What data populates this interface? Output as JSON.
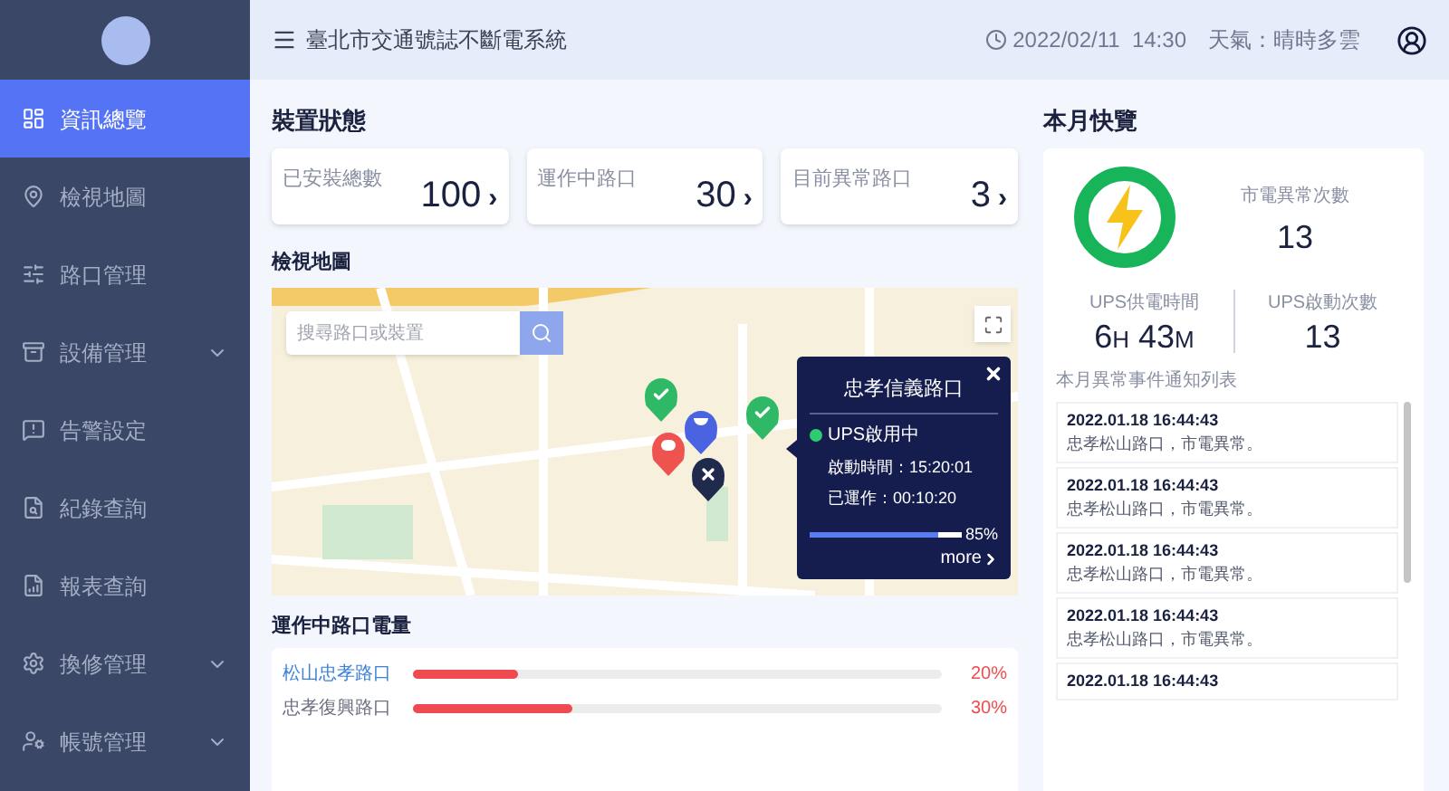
{
  "header": {
    "title": "臺北市交通號誌不斷電系統",
    "datetime": "2022/02/11  14:30",
    "weather": "天氣：晴時多雲"
  },
  "sidebar": {
    "items": [
      {
        "label": "資訊總覽",
        "selected": true,
        "expandable": false
      },
      {
        "label": "檢視地圖",
        "selected": false,
        "expandable": false
      },
      {
        "label": "路口管理",
        "selected": false,
        "expandable": false
      },
      {
        "label": "設備管理",
        "selected": false,
        "expandable": true
      },
      {
        "label": "告警設定",
        "selected": false,
        "expandable": false
      },
      {
        "label": "紀錄查詢",
        "selected": false,
        "expandable": false
      },
      {
        "label": "報表查詢",
        "selected": false,
        "expandable": false
      },
      {
        "label": "換修管理",
        "selected": false,
        "expandable": true
      },
      {
        "label": "帳號管理",
        "selected": false,
        "expandable": true
      }
    ]
  },
  "device_status": {
    "title": "裝置狀態",
    "cards": [
      {
        "label": "已安裝總數",
        "value": "100",
        "arrow": "›"
      },
      {
        "label": "運作中路口",
        "value": "30",
        "arrow": "›"
      },
      {
        "label": "目前異常路口",
        "value": "3",
        "arrow": "›"
      }
    ]
  },
  "map": {
    "title": "檢視地圖",
    "search": {
      "placeholder": "搜尋路口或裝置"
    },
    "pins": [
      {
        "kind": "ok",
        "color": "#2fb865"
      },
      {
        "kind": "standby",
        "color": "#4a63e0"
      },
      {
        "kind": "ok",
        "color": "#2fb865"
      },
      {
        "kind": "alarm",
        "color": "#ef5350"
      },
      {
        "kind": "offline",
        "color": "#1f2a4d"
      }
    ],
    "popup": {
      "title": "忠孝信義路口",
      "status": {
        "text": "UPS啟用中",
        "color": "#2ecc71"
      },
      "start": "啟動時間：15:20:01",
      "runtime": "已運作：00:10:20",
      "level": 0.85,
      "reading": "85%",
      "more": "more"
    }
  },
  "power": {
    "title": "運作中路口電量",
    "rows": [
      {
        "name": "松山忠孝路口",
        "selected": true,
        "level": 0.2,
        "reading": "20%"
      },
      {
        "name": "忠孝復興路口",
        "selected": false,
        "level": 0.3,
        "reading": "30%"
      }
    ]
  },
  "monthly": {
    "title": "本月快覽",
    "mains_label": "市電異常次數",
    "mains_value": "13",
    "ups_time_label": "UPS供電時間",
    "ups_hours": "6",
    "ups_h_unit": "H",
    "ups_minutes": "43",
    "ups_m_unit": "M",
    "ups_count_label": "UPS啟動次數",
    "ups_count": "13",
    "events_title": "本月異常事件通知列表",
    "events": [
      {
        "time": "2022.01.18 16:44:43",
        "text": "忠孝松山路口，市電異常。"
      },
      {
        "time": "2022.01.18 16:44:43",
        "text": "忠孝松山路口，市電異常。"
      },
      {
        "time": "2022.01.18 16:44:43",
        "text": "忠孝松山路口，市電異常。"
      },
      {
        "time": "2022.01.18 16:44:43",
        "text": "忠孝松山路口，市電異常。"
      },
      {
        "time": "2022.01.18 16:44:43"
      }
    ]
  }
}
